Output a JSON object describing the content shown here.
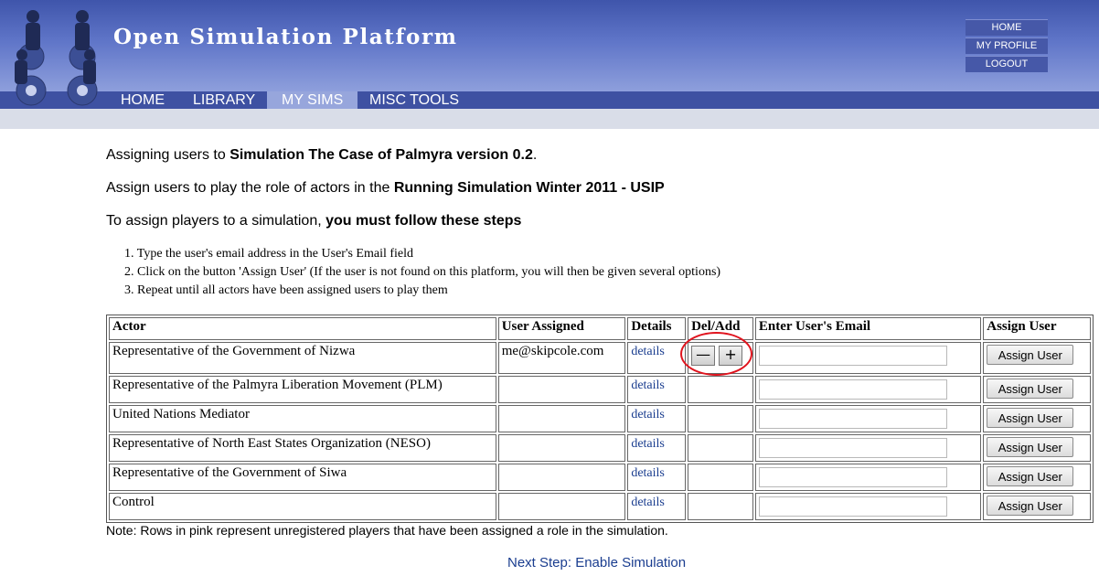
{
  "header": {
    "title": "Open Simulation Platform",
    "top_menu": [
      "HOME",
      "MY PROFILE",
      "LOGOUT"
    ]
  },
  "nav": {
    "tabs": [
      "HOME",
      "LIBRARY",
      "MY SIMS",
      "MISC TOOLS"
    ],
    "active": "MY SIMS"
  },
  "intro": {
    "line1_prefix": "Assigning users to ",
    "line1_bold": "Simulation The Case of Palmyra version 0.2",
    "line1_suffix": ".",
    "line2_prefix": "Assign users to play the role of actors in the ",
    "line2_bold": "Running Simulation Winter 2011 - USIP",
    "line3_prefix": "To assign players to a simulation, ",
    "line3_bold": "you must follow these steps"
  },
  "steps": [
    "1.  Type the user's email address in the User's Email field",
    "2.  Click on the button 'Assign User' (If the user is not found on this platform, you will then be given several options)",
    "3.  Repeat until all actors have been assigned users to play them"
  ],
  "table": {
    "headers": [
      "Actor",
      "User Assigned",
      "Details",
      "Del/Add",
      "Enter User's Email",
      "Assign User"
    ],
    "details_label": "details",
    "assign_label": "Assign User",
    "del_symbol": "—",
    "add_symbol": "+",
    "rows": [
      {
        "actor": "Representative of the Government of Nizwa",
        "user": "me@skipcole.com"
      },
      {
        "actor": "Representative of the Palmyra Liberation Movement (PLM)",
        "user": ""
      },
      {
        "actor": "United Nations Mediator",
        "user": ""
      },
      {
        "actor": "Representative of North East States Organization (NESO)",
        "user": ""
      },
      {
        "actor": "Representative of the Government of Siwa",
        "user": ""
      },
      {
        "actor": "Control",
        "user": ""
      }
    ]
  },
  "note": "Note: Rows in pink represent unregistered players that have been assigned a role in the simulation.",
  "next_step": "Next Step: Enable Simulation",
  "colors": {
    "header_dark": "#3f55ab",
    "nav": "#3e51a2",
    "active_tab": "#97a6dc",
    "annotation": "#e0141e",
    "link": "#1a3d8f"
  }
}
